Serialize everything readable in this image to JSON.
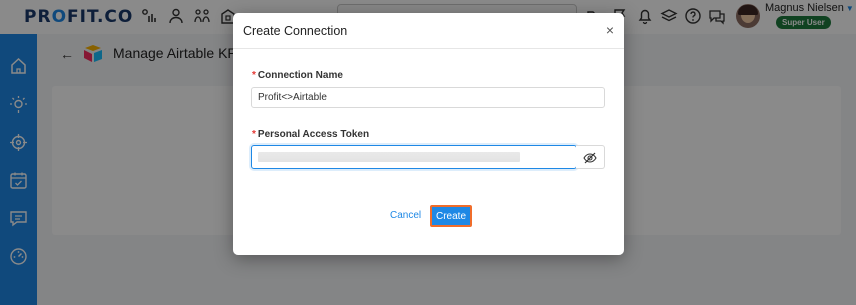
{
  "brand": {
    "logo_text_prefix": "PR",
    "logo_text_o": "O",
    "logo_text_suffix": "FIT.CO"
  },
  "user": {
    "name": "Magnus Nielsen",
    "role": "Super User"
  },
  "page": {
    "title": "Manage Airtable KPI C"
  },
  "modal": {
    "title": "Create Connection",
    "close_label": "×",
    "fields": {
      "connection_name": {
        "label": "Connection Name",
        "value": "Profit<>Airtable"
      },
      "access_token": {
        "label": "Personal Access Token"
      }
    },
    "cancel_label": "Cancel",
    "create_label": "Create"
  },
  "colors": {
    "accent": "#1e88e5",
    "highlight_border": "#f06d2b",
    "badge": "#1f7a3e",
    "required": "#e53935"
  }
}
